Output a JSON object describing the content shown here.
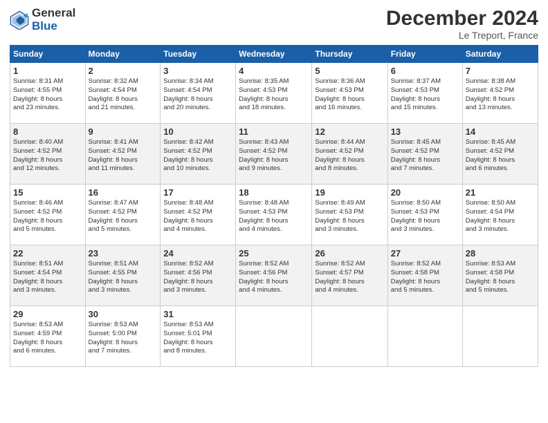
{
  "header": {
    "logo_line1": "General",
    "logo_line2": "Blue",
    "month_title": "December 2024",
    "location": "Le Treport, France"
  },
  "weekdays": [
    "Sunday",
    "Monday",
    "Tuesday",
    "Wednesday",
    "Thursday",
    "Friday",
    "Saturday"
  ],
  "weeks": [
    [
      {
        "day": "1",
        "info": "Sunrise: 8:31 AM\nSunset: 4:55 PM\nDaylight: 8 hours\nand 23 minutes."
      },
      {
        "day": "2",
        "info": "Sunrise: 8:32 AM\nSunset: 4:54 PM\nDaylight: 8 hours\nand 21 minutes."
      },
      {
        "day": "3",
        "info": "Sunrise: 8:34 AM\nSunset: 4:54 PM\nDaylight: 8 hours\nand 20 minutes."
      },
      {
        "day": "4",
        "info": "Sunrise: 8:35 AM\nSunset: 4:53 PM\nDaylight: 8 hours\nand 18 minutes."
      },
      {
        "day": "5",
        "info": "Sunrise: 8:36 AM\nSunset: 4:53 PM\nDaylight: 8 hours\nand 16 minutes."
      },
      {
        "day": "6",
        "info": "Sunrise: 8:37 AM\nSunset: 4:53 PM\nDaylight: 8 hours\nand 15 minutes."
      },
      {
        "day": "7",
        "info": "Sunrise: 8:38 AM\nSunset: 4:52 PM\nDaylight: 8 hours\nand 13 minutes."
      }
    ],
    [
      {
        "day": "8",
        "info": "Sunrise: 8:40 AM\nSunset: 4:52 PM\nDaylight: 8 hours\nand 12 minutes."
      },
      {
        "day": "9",
        "info": "Sunrise: 8:41 AM\nSunset: 4:52 PM\nDaylight: 8 hours\nand 11 minutes."
      },
      {
        "day": "10",
        "info": "Sunrise: 8:42 AM\nSunset: 4:52 PM\nDaylight: 8 hours\nand 10 minutes."
      },
      {
        "day": "11",
        "info": "Sunrise: 8:43 AM\nSunset: 4:52 PM\nDaylight: 8 hours\nand 9 minutes."
      },
      {
        "day": "12",
        "info": "Sunrise: 8:44 AM\nSunset: 4:52 PM\nDaylight: 8 hours\nand 8 minutes."
      },
      {
        "day": "13",
        "info": "Sunrise: 8:45 AM\nSunset: 4:52 PM\nDaylight: 8 hours\nand 7 minutes."
      },
      {
        "day": "14",
        "info": "Sunrise: 8:45 AM\nSunset: 4:52 PM\nDaylight: 8 hours\nand 6 minutes."
      }
    ],
    [
      {
        "day": "15",
        "info": "Sunrise: 8:46 AM\nSunset: 4:52 PM\nDaylight: 8 hours\nand 5 minutes."
      },
      {
        "day": "16",
        "info": "Sunrise: 8:47 AM\nSunset: 4:52 PM\nDaylight: 8 hours\nand 5 minutes."
      },
      {
        "day": "17",
        "info": "Sunrise: 8:48 AM\nSunset: 4:52 PM\nDaylight: 8 hours\nand 4 minutes."
      },
      {
        "day": "18",
        "info": "Sunrise: 8:48 AM\nSunset: 4:53 PM\nDaylight: 8 hours\nand 4 minutes."
      },
      {
        "day": "19",
        "info": "Sunrise: 8:49 AM\nSunset: 4:53 PM\nDaylight: 8 hours\nand 3 minutes."
      },
      {
        "day": "20",
        "info": "Sunrise: 8:50 AM\nSunset: 4:53 PM\nDaylight: 8 hours\nand 3 minutes."
      },
      {
        "day": "21",
        "info": "Sunrise: 8:50 AM\nSunset: 4:54 PM\nDaylight: 8 hours\nand 3 minutes."
      }
    ],
    [
      {
        "day": "22",
        "info": "Sunrise: 8:51 AM\nSunset: 4:54 PM\nDaylight: 8 hours\nand 3 minutes."
      },
      {
        "day": "23",
        "info": "Sunrise: 8:51 AM\nSunset: 4:55 PM\nDaylight: 8 hours\nand 3 minutes."
      },
      {
        "day": "24",
        "info": "Sunrise: 8:52 AM\nSunset: 4:56 PM\nDaylight: 8 hours\nand 3 minutes."
      },
      {
        "day": "25",
        "info": "Sunrise: 8:52 AM\nSunset: 4:56 PM\nDaylight: 8 hours\nand 4 minutes."
      },
      {
        "day": "26",
        "info": "Sunrise: 8:52 AM\nSunset: 4:57 PM\nDaylight: 8 hours\nand 4 minutes."
      },
      {
        "day": "27",
        "info": "Sunrise: 8:52 AM\nSunset: 4:58 PM\nDaylight: 8 hours\nand 5 minutes."
      },
      {
        "day": "28",
        "info": "Sunrise: 8:53 AM\nSunset: 4:58 PM\nDaylight: 8 hours\nand 5 minutes."
      }
    ],
    [
      {
        "day": "29",
        "info": "Sunrise: 8:53 AM\nSunset: 4:59 PM\nDaylight: 8 hours\nand 6 minutes."
      },
      {
        "day": "30",
        "info": "Sunrise: 8:53 AM\nSunset: 5:00 PM\nDaylight: 8 hours\nand 7 minutes."
      },
      {
        "day": "31",
        "info": "Sunrise: 8:53 AM\nSunset: 5:01 PM\nDaylight: 8 hours\nand 8 minutes."
      },
      null,
      null,
      null,
      null
    ]
  ]
}
